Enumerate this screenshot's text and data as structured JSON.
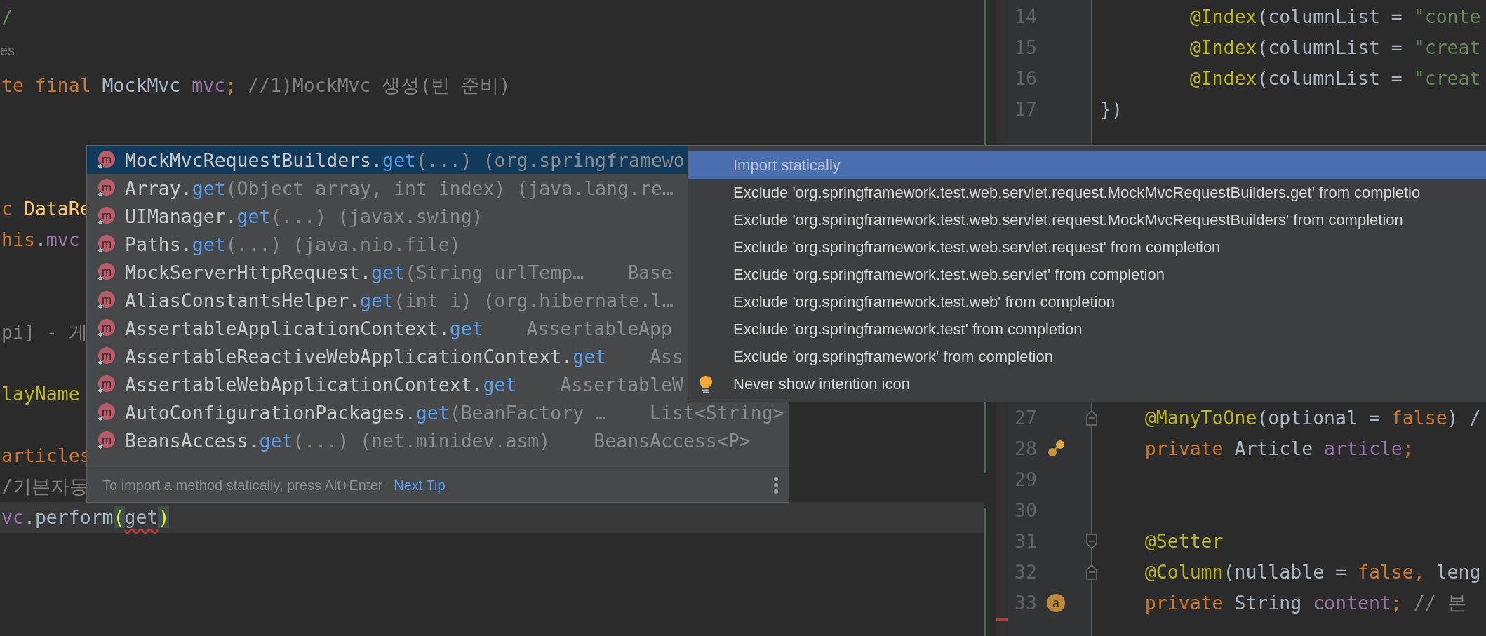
{
  "left_editor": {
    "lines": [
      {
        "kind": "code",
        "current": false,
        "tokens": [
          {
            "text": "/",
            "kind": "doc"
          }
        ]
      },
      {
        "kind": "hint",
        "text": "es"
      },
      {
        "kind": "code",
        "current": false,
        "tokens": [
          {
            "text": "te final ",
            "kind": "keyword"
          },
          {
            "text": "MockMvc ",
            "kind": "plain"
          },
          {
            "text": "mvc",
            "kind": "field"
          },
          {
            "text": ";",
            "kind": "keyword"
          },
          {
            "text": " //1)MockMvc 생성(빈 준비)",
            "kind": "comment"
          }
        ]
      },
      {
        "kind": "blank",
        "current": false
      },
      {
        "kind": "blank",
        "current": false
      },
      {
        "kind": "blank",
        "current": false
      },
      {
        "kind": "code",
        "current": false,
        "tokens": [
          {
            "text": "c ",
            "kind": "keyword"
          },
          {
            "text": "DataRe",
            "kind": "method"
          }
        ]
      },
      {
        "kind": "code",
        "current": false,
        "tokens": [
          {
            "text": "his",
            "kind": "keyword"
          },
          {
            "text": ".",
            "kind": "plain"
          },
          {
            "text": "mvc",
            "kind": "field"
          }
        ]
      },
      {
        "kind": "blank",
        "current": false
      },
      {
        "kind": "blank",
        "current": false
      },
      {
        "kind": "code",
        "current": false,
        "tokens": [
          {
            "text": "pi] - 게",
            "kind": "comment"
          }
        ]
      },
      {
        "kind": "blank",
        "current": false
      },
      {
        "kind": "code",
        "current": false,
        "tokens": [
          {
            "text": "layName",
            "kind": "annotation"
          }
        ]
      },
      {
        "kind": "blank",
        "current": false
      },
      {
        "kind": "code",
        "current": false,
        "tokens": [
          {
            "text": "articles",
            "kind": "keyword"
          }
        ]
      },
      {
        "kind": "code",
        "current": false,
        "tokens": [
          {
            "text": "/기본자동",
            "kind": "comment"
          }
        ]
      },
      {
        "kind": "code",
        "current": true,
        "tokens": [
          {
            "text": "vc",
            "kind": "field"
          },
          {
            "text": ".perform",
            "kind": "plain"
          },
          {
            "text": "(",
            "kind": "brace"
          },
          {
            "text": "get",
            "kind": "error"
          },
          {
            "text": ")",
            "kind": "brace"
          }
        ]
      }
    ]
  },
  "right_editor": {
    "lines": [
      {
        "number": "14",
        "tokens": [
          {
            "text": "        @Index",
            "kind": "annotation"
          },
          {
            "text": "(columnList = ",
            "kind": "plain"
          },
          {
            "text": "\"conte",
            "kind": "string"
          }
        ]
      },
      {
        "number": "15",
        "tokens": [
          {
            "text": "        @Index",
            "kind": "annotation"
          },
          {
            "text": "(columnList = ",
            "kind": "plain"
          },
          {
            "text": "\"creat",
            "kind": "string"
          }
        ]
      },
      {
        "number": "16",
        "tokens": [
          {
            "text": "        @Index",
            "kind": "annotation"
          },
          {
            "text": "(columnList = ",
            "kind": "plain"
          },
          {
            "text": "\"creat",
            "kind": "string"
          }
        ]
      },
      {
        "number": "17",
        "tokens": [
          {
            "text": "})",
            "kind": "plain"
          }
        ]
      },
      {
        "number": "27",
        "fold": {
          "kind": "end"
        },
        "tokens": [
          {
            "text": "    @ManyToOne",
            "kind": "annotation"
          },
          {
            "text": "(optional = ",
            "kind": "plain"
          },
          {
            "text": "false",
            "kind": "keyword"
          },
          {
            "text": ") /",
            "kind": "plain"
          }
        ]
      },
      {
        "number": "28",
        "gutter": {
          "kind": "relation"
        },
        "tokens": [
          {
            "text": "    private ",
            "kind": "keyword"
          },
          {
            "text": "Article ",
            "kind": "plain"
          },
          {
            "text": "article",
            "kind": "field"
          },
          {
            "text": ";",
            "kind": "keyword"
          }
        ]
      },
      {
        "number": "29"
      },
      {
        "number": "30"
      },
      {
        "number": "31",
        "fold": {
          "kind": "start"
        },
        "tokens": [
          {
            "text": "    @Setter",
            "kind": "annotation"
          }
        ]
      },
      {
        "number": "32",
        "fold": {
          "kind": "end"
        },
        "tokens": [
          {
            "text": "    @Column",
            "kind": "annotation"
          },
          {
            "text": "(nullable = ",
            "kind": "plain"
          },
          {
            "text": "false, ",
            "kind": "keyword"
          },
          {
            "text": "leng",
            "kind": "plain"
          }
        ]
      },
      {
        "number": "33",
        "gutter": {
          "kind": "badge",
          "text": "a"
        },
        "tokens": [
          {
            "text": "    private ",
            "kind": "keyword"
          },
          {
            "text": "String ",
            "kind": "plain"
          },
          {
            "text": "content",
            "kind": "field"
          },
          {
            "text": "; ",
            "kind": "keyword"
          },
          {
            "text": "// 본",
            "kind": "comment"
          }
        ]
      }
    ]
  },
  "completion_popup": {
    "items": [
      {
        "icon": "m",
        "name": "MockMvcRequestBuilders.",
        "method": "get",
        "tail": "(...) (org.springframewo",
        "selected": true
      },
      {
        "icon": "m",
        "name": "Array.",
        "method": "get",
        "tail": "(Object array, int index) (java.lang.re…",
        "selected": false
      },
      {
        "icon": "m",
        "name": "UIManager.",
        "method": "get",
        "tail": "(...) (javax.swing)",
        "selected": false
      },
      {
        "icon": "m",
        "name": "Paths.",
        "method": "get",
        "tail": "(...) (java.nio.file)",
        "selected": false
      },
      {
        "icon": "m",
        "name": "MockServerHttpRequest.",
        "method": "get",
        "tail": "(String urlTemp…",
        "type": "Base",
        "selected": false
      },
      {
        "icon": "m",
        "name": "AliasConstantsHelper.",
        "method": "get",
        "tail": "(int i) (org.hibernate.l…",
        "selected": false
      },
      {
        "icon": "m",
        "name": "AssertableApplicationContext.",
        "method": "get",
        "type": "AssertableApp",
        "selected": false
      },
      {
        "icon": "m",
        "name": "AssertableReactiveWebApplicationContext.",
        "method": "get",
        "type": "Ass",
        "selected": false
      },
      {
        "icon": "m",
        "name": "AssertableWebApplicationContext.",
        "method": "get",
        "type": "AssertableW",
        "selected": false
      },
      {
        "icon": "m",
        "name": "AutoConfigurationPackages.",
        "method": "get",
        "tail": "(BeanFactory …",
        "type": "List<String>",
        "selected": false
      },
      {
        "icon": "m",
        "name": "BeansAccess.",
        "method": "get",
        "tail": "(...) (net.minidev.asm)",
        "type": "BeansAccess<P>",
        "selected": false
      }
    ],
    "footer": {
      "tip": "To import a method statically, press Alt+Enter",
      "link": "Next Tip"
    }
  },
  "intention_menu": {
    "items": [
      {
        "text": "Import statically",
        "kind": "action",
        "selected": true
      },
      {
        "text": "Exclude 'org.springframework.test.web.servlet.request.MockMvcRequestBuilders.get' from completio",
        "kind": "action",
        "selected": false
      },
      {
        "text": "Exclude 'org.springframework.test.web.servlet.request.MockMvcRequestBuilders' from completion",
        "kind": "action",
        "selected": false
      },
      {
        "text": "Exclude 'org.springframework.test.web.servlet.request' from completion",
        "kind": "action",
        "selected": false
      },
      {
        "text": "Exclude 'org.springframework.test.web.servlet' from completion",
        "kind": "action",
        "selected": false
      },
      {
        "text": "Exclude 'org.springframework.test.web' from completion",
        "kind": "action",
        "selected": false
      },
      {
        "text": "Exclude 'org.springframework.test' from completion",
        "kind": "action",
        "selected": false
      },
      {
        "text": "Exclude 'org.springframework' from completion",
        "kind": "action",
        "selected": false
      },
      {
        "text": "Never show intention icon",
        "kind": "setting",
        "selected": false
      }
    ]
  }
}
